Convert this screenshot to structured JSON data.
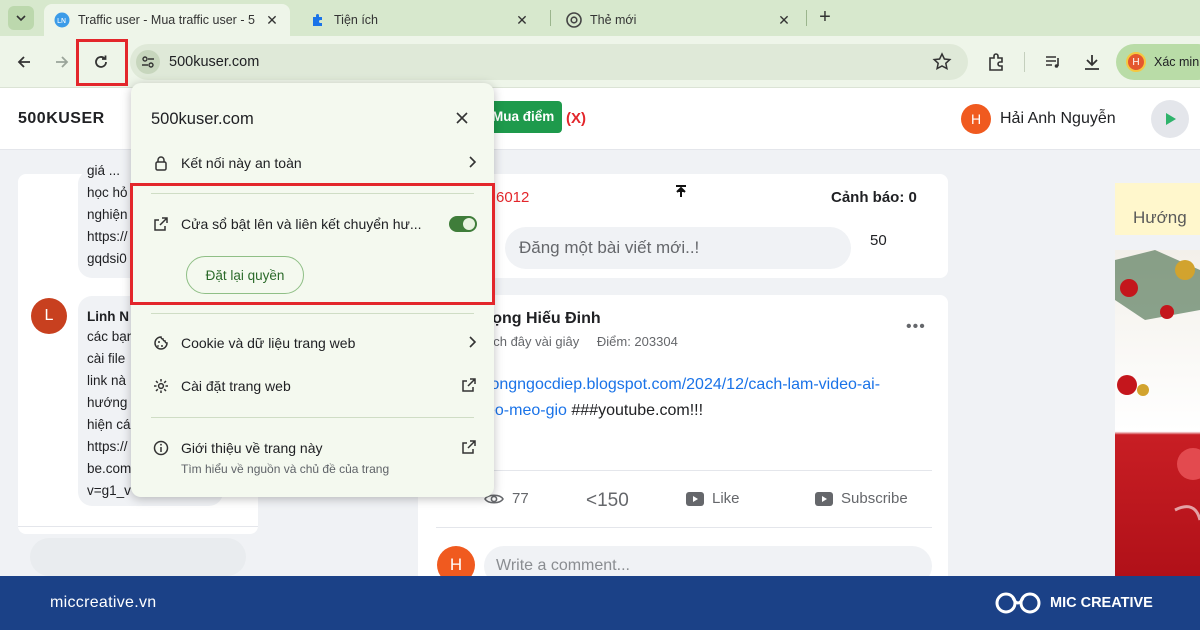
{
  "browser": {
    "tabs": [
      {
        "title": "Traffic user - Mua traffic user - 5",
        "active": true
      },
      {
        "title": "Tiện ích",
        "active": false
      },
      {
        "title": "Thẻ mới",
        "active": false
      }
    ],
    "url": "500kuser.com",
    "profile_label": "Xác min",
    "profile_initial": "H"
  },
  "header": {
    "logo": "500KUSER",
    "buy_points": "Mua điểm",
    "buy_points_x": "(X)",
    "user_initial": "H",
    "user_name": "Hải Anh Nguyễn"
  },
  "left_column": {
    "bubble1_lines": "giá ...\nhọc hỏ\nnghiện\nhttps://\ngqdsi0",
    "commenter_initial": "L",
    "commenter_name": "Linh N",
    "bubble2_lines": "các bạn\ncài file\nlink nà\nhướng\nhiện cá\nhttps://\nbe.com\nv=g1_v"
  },
  "feed": {
    "code_number": "6012",
    "warning": "Cảnh báo: 0",
    "post_placeholder": "Đăng một bài viết mới..!",
    "post_count": "50",
    "poster_name": "rọng Hiếu Đinh",
    "post_time": "ách đây vài giây",
    "post_points": "Điểm: 203304",
    "link_line1": "tongngocdiep.blogspot.com/2024/12/cach-lam-video-ai-",
    "link_line2_blue": "eo-meo-gio",
    "link_line2_rest": " ###youtube.com!!!",
    "views": "77",
    "limit": "<150",
    "like": "Like",
    "subscribe": "Subscribe",
    "comment_initial": "H",
    "comment_placeholder": "Write a comment..."
  },
  "right_column": {
    "banner_text": "Hướng"
  },
  "site_popup": {
    "title": "500kuser.com",
    "secure_connection": "Kết nối này an toàn",
    "popups_redirects": "Cửa sổ bật lên và liên kết chuyển hư...",
    "popups_enabled": true,
    "reset_permissions": "Đặt lại quyền",
    "cookies": "Cookie và dữ liệu trang web",
    "site_settings": "Cài đặt trang web",
    "about_page": "Giới thiệu về trang này",
    "about_sub": "Tìm hiểu về nguồn và chủ đề của trang"
  },
  "footer": {
    "website": "miccreative.vn",
    "brand": "MIC CREATIVE"
  },
  "colors": {
    "highlight_red": "#e3262b",
    "buy_green": "#1e9a4c",
    "footer_blue": "#1b4187",
    "toggle_green": "#3f7d3a"
  }
}
